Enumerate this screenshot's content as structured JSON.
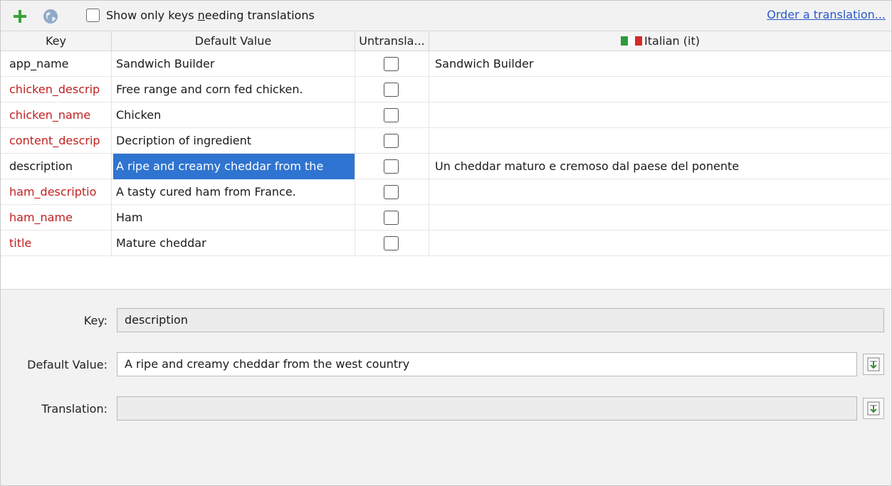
{
  "toolbar": {
    "add_icon": "add-plus-icon",
    "globe_icon": "globe-icon",
    "filter_label_pre": "Show only keys ",
    "filter_label_mnemonic": "n",
    "filter_label_post": "eeding translations",
    "filter_checked": false,
    "order_link": "Order a translation..."
  },
  "table": {
    "headers": {
      "key": "Key",
      "default_value": "Default Value",
      "untranslatable": "Untransla...",
      "locale": "Italian (it)"
    },
    "rows": [
      {
        "key": "app_name",
        "default": "Sandwich Builder",
        "untranslatable": false,
        "translation": "Sandwich Builder",
        "missing": false
      },
      {
        "key": "chicken_descrip",
        "default": "Free range and corn fed chicken.",
        "untranslatable": false,
        "translation": "",
        "missing": true
      },
      {
        "key": "chicken_name",
        "default": "Chicken",
        "untranslatable": false,
        "translation": "",
        "missing": true
      },
      {
        "key": "content_descrip",
        "default": "Decription of ingredient",
        "untranslatable": false,
        "translation": "",
        "missing": true
      },
      {
        "key": "description",
        "default": "A ripe and creamy cheddar from the",
        "untranslatable": false,
        "translation": "Un cheddar maturo e cremoso dal paese del ponente",
        "missing": false,
        "selected": true
      },
      {
        "key": "ham_descriptio",
        "default": "A tasty cured ham from France.",
        "untranslatable": false,
        "translation": "",
        "missing": true
      },
      {
        "key": "ham_name",
        "default": "Ham",
        "untranslatable": false,
        "translation": "",
        "missing": true
      },
      {
        "key": "title",
        "default": "Mature cheddar",
        "untranslatable": false,
        "translation": "",
        "missing": true
      }
    ]
  },
  "editor": {
    "key_label": "Key:",
    "key_value": "description",
    "default_label": "Default Value:",
    "default_value": "A ripe and creamy cheddar from the west country",
    "translation_label": "Translation:",
    "translation_value": "",
    "edit_icon": "multiline-edit-icon"
  },
  "colors": {
    "missing_key": "#c02020",
    "selection": "#2f74d0",
    "link": "#2a58c8",
    "flag_green": "#2e9b3c",
    "flag_white": "#ffffff",
    "flag_red": "#d42a2a"
  }
}
